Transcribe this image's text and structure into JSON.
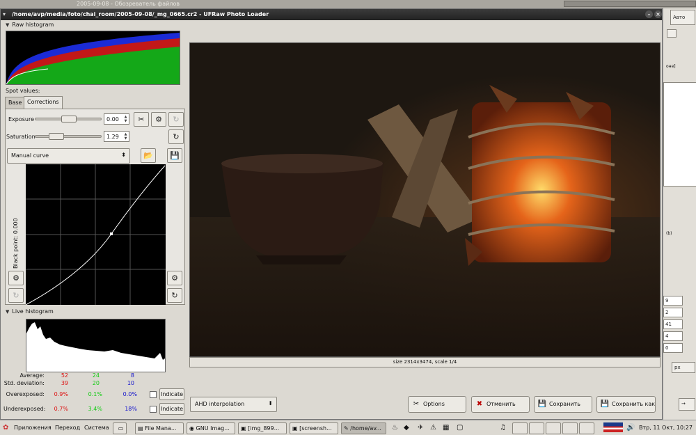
{
  "background": {
    "top_title": "2005-09-08 - Обозреватель файлов",
    "right_fragments": [
      "Авто",
      "оне]",
      "(b)",
      "9",
      "2",
      "41",
      "4",
      "0",
      "px",
      "→"
    ]
  },
  "window": {
    "title": "/home/avp/media/foto/chai_room/2005-09-08/_mg_0665.cr2 - UFRaw Photo Loader"
  },
  "left": {
    "raw_histogram_label": "Raw histogram",
    "spot_values_label": "Spot values:",
    "tabs": [
      "Base",
      "Corrections"
    ],
    "exposure_label": "Exposure",
    "exposure_value": "0.00",
    "exposure_level": 0.5,
    "saturation_label": "Saturation",
    "saturation_value": "1.29",
    "saturation_level": 0.25,
    "curve_label": "Manual curve",
    "black_point": "Black point: 0.000",
    "live_histogram_label": "Live histogram",
    "stats": {
      "average_label": "Average:",
      "average": [
        "52",
        "24",
        "8"
      ],
      "stddev_label": "Std. deviation:",
      "stddev": [
        "39",
        "20",
        "10"
      ],
      "over_label": "Overexposed:",
      "over": [
        "0.9%",
        "0.1%",
        "0.0%"
      ],
      "under_label": "Underexposed:",
      "under": [
        "0.7%",
        "3.4%",
        "18%"
      ],
      "indicate": "Indicate"
    }
  },
  "preview": {
    "size_text": "size 2314x3474, scale 1/4"
  },
  "bottom": {
    "interpolation": "AHD interpolation",
    "options": "Options",
    "cancel": "Отменить",
    "save": "Сохранить",
    "save_as": "Сохранить как"
  },
  "taskbar": {
    "apps": "Приложения",
    "places": "Переход",
    "system": "Система",
    "tasks": [
      "File Mana...",
      "GNU Imag...",
      "[img_899...",
      "[screensh...",
      "/home/av..."
    ],
    "clock": "Втр, 11 Окт, 10:27"
  },
  "colors": {
    "accent_red": "#d11",
    "accent_green": "#1c1",
    "accent_blue": "#11c"
  }
}
